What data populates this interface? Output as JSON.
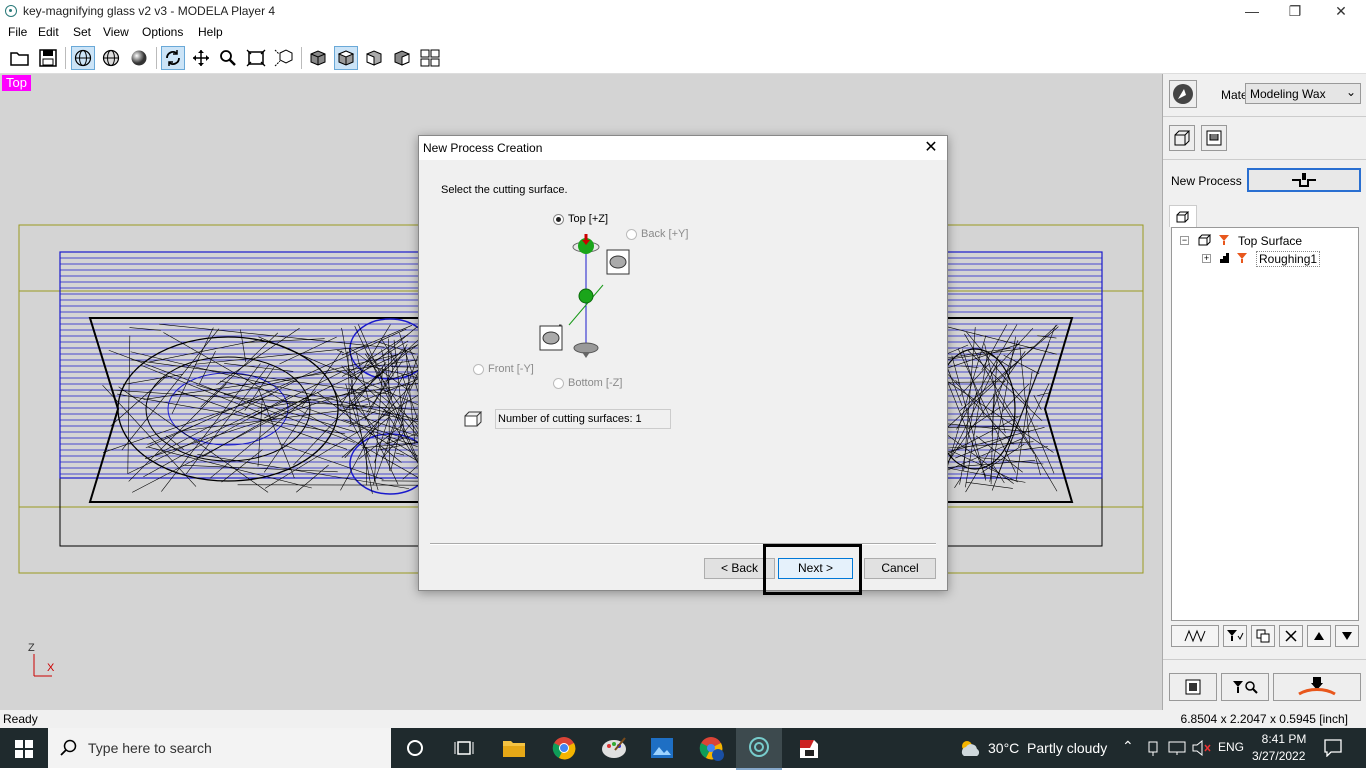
{
  "window": {
    "title": "key-magnifying glass v2 v3 - MODELA Player 4",
    "minimize_glyph": "—",
    "restore_glyph": "❐",
    "close_glyph": "✕"
  },
  "menu": [
    "File",
    "Edit",
    "Set",
    "View",
    "Options",
    "Help"
  ],
  "toolbar_icons": [
    "open-folder-icon",
    "save-icon",
    "wireframe-icon",
    "shaded-globe-icon",
    "sphere-icon",
    "rotate-icon",
    "pan-icon",
    "zoom-icon",
    "fit-icon",
    "zoom-box-icon",
    "cube-front-icon",
    "cube-top-icon",
    "cube-side-icon",
    "cube-iso-icon",
    "multi-view-icon"
  ],
  "viewport": {
    "view_label": "Top",
    "axis_z": "Z",
    "axis_x": "X"
  },
  "right_panel": {
    "material_label": "Material",
    "material_value": "Modeling Wax",
    "new_process_label": "New Process",
    "tree": {
      "root": "Top Surface",
      "child": "Roughing1"
    },
    "expand_glyph": "−",
    "collapse_glyph": "+"
  },
  "dialog": {
    "title": "New Process Creation",
    "close_glyph": "✕",
    "instruction": "Select the cutting surface.",
    "options": {
      "top": "Top [+Z]",
      "back": "Back [+Y]",
      "front": "Front [-Y]",
      "bottom": "Bottom [-Z]"
    },
    "selected": "top",
    "count_text": "Number of cutting surfaces: 1",
    "buttons": {
      "back": "< Back",
      "next": "Next >",
      "cancel": "Cancel"
    }
  },
  "status": {
    "left": "Ready",
    "right": "6.8504 x 2.2047 x 0.5945 [inch]"
  },
  "taskbar": {
    "search_placeholder": "Type here to search",
    "weather": "30°C  Partly cloudy",
    "language": "ENG",
    "time": "8:41 PM",
    "date": "3/27/2022"
  },
  "colors": {
    "view_label_bg": "#ff00ff",
    "mesh_blue": "#1a1acc",
    "stock_outline": "#9a9a20",
    "highlight_box": "#000000",
    "orange": "#e8571c"
  }
}
